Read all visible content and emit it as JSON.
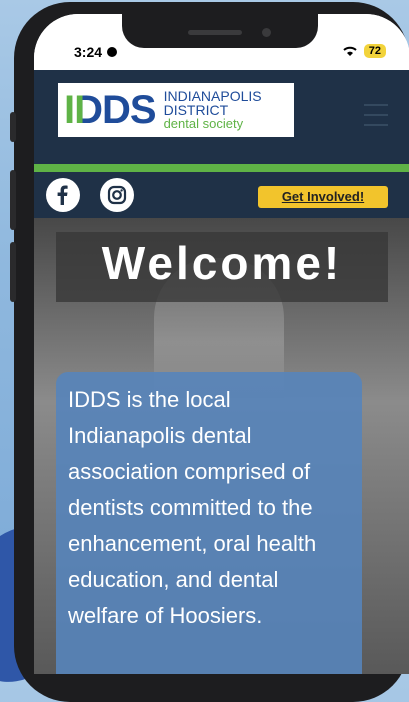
{
  "status_bar": {
    "time": "3:24",
    "battery": "72"
  },
  "header": {
    "logo_mark": "IDDS",
    "logo_line1": "INDIANAPOLIS",
    "logo_line2": "DISTRICT",
    "logo_line3": "dental society"
  },
  "social": {
    "cta_label": "Get Involved!"
  },
  "hero": {
    "title": "Welcome!",
    "description": "IDDS is the local Indianapolis dental association comprised of dentists committed to the enhancement, oral health education, and dental welfare of Hoosiers."
  },
  "colors": {
    "navy": "#1f3147",
    "green": "#5fb346",
    "yellow": "#f2c42c",
    "box_blue": "#5684ba"
  }
}
